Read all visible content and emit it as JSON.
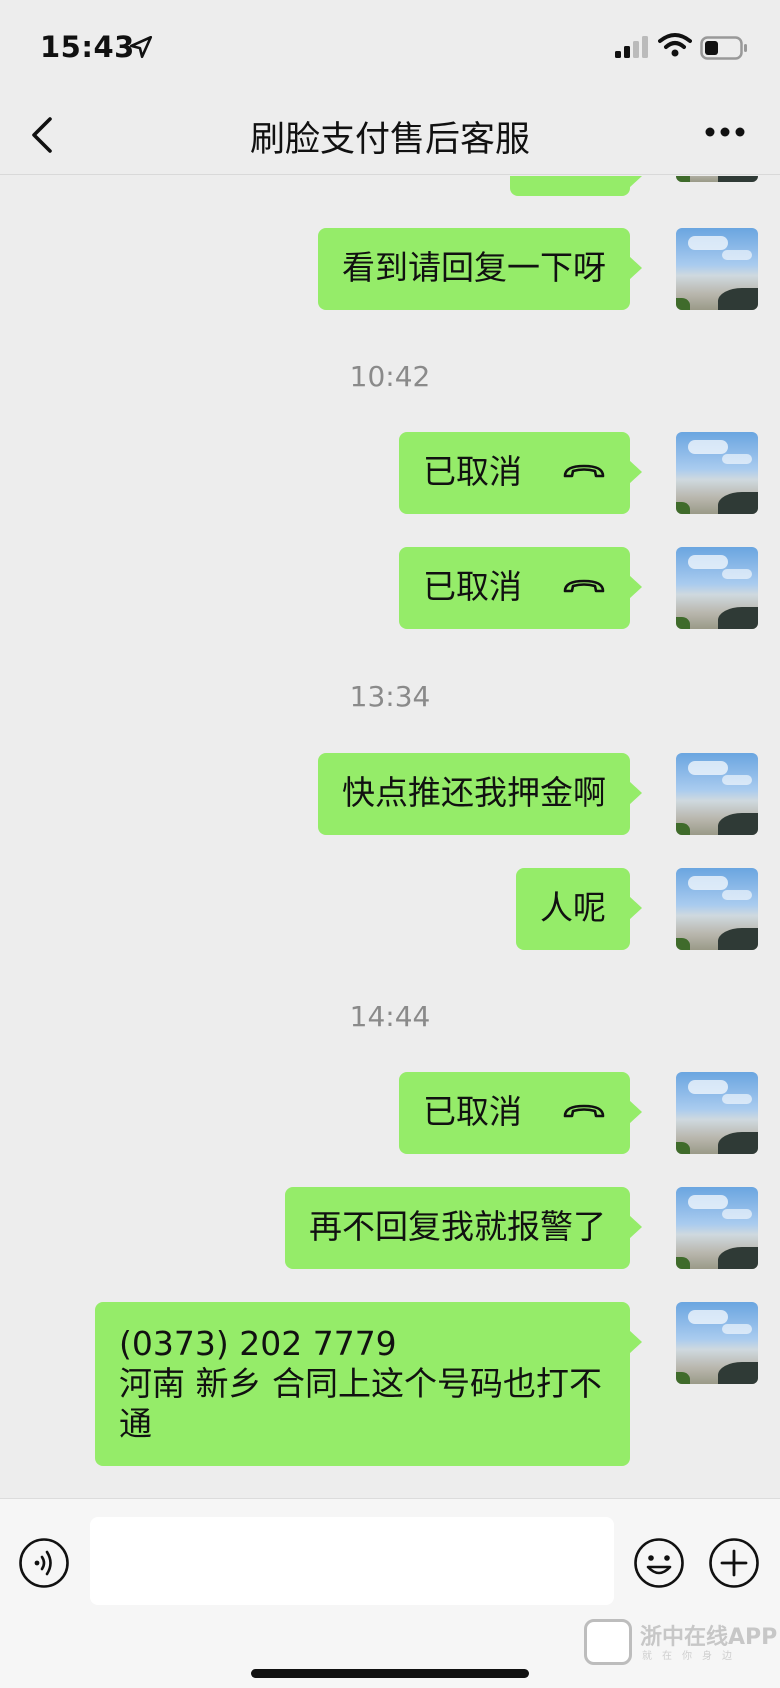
{
  "status_bar": {
    "time": "15:43"
  },
  "nav": {
    "title": "刷脸支付售后客服"
  },
  "messages": [
    {
      "type": "text",
      "text": "看到请回复一下呀"
    },
    {
      "type": "time",
      "text": "10:42"
    },
    {
      "type": "call",
      "text": "已取消"
    },
    {
      "type": "call",
      "text": "已取消"
    },
    {
      "type": "time",
      "text": "13:34"
    },
    {
      "type": "text",
      "text": "快点推还我押金啊"
    },
    {
      "type": "text",
      "text": "人呢"
    },
    {
      "type": "time",
      "text": "14:44"
    },
    {
      "type": "call",
      "text": "已取消"
    },
    {
      "type": "text",
      "text": "再不回复我就报警了"
    },
    {
      "type": "text",
      "line1": "(0373) 202 7779",
      "line2": "河南 新乡  合同上这个号码也打不通"
    }
  ],
  "watermark": {
    "text": "浙中在线APP",
    "sub": "就在你身边"
  },
  "colors": {
    "bubble": "#95ec69",
    "background": "#ededed"
  }
}
